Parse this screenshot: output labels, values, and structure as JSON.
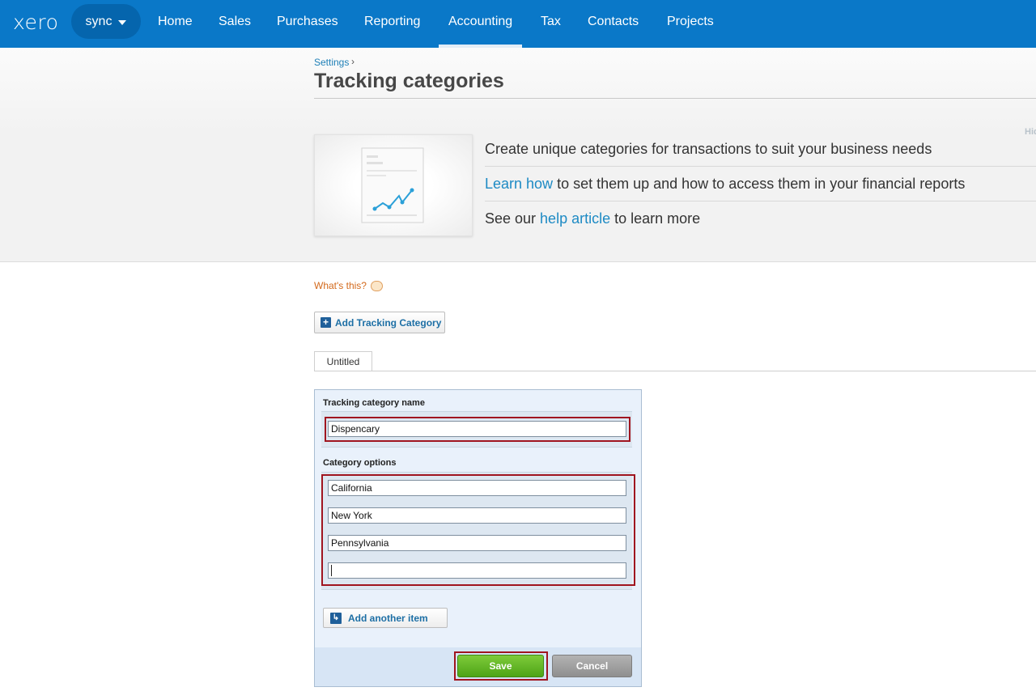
{
  "nav": {
    "logo": "xero",
    "org": "sync",
    "items": [
      {
        "label": "Home"
      },
      {
        "label": "Sales"
      },
      {
        "label": "Purchases"
      },
      {
        "label": "Reporting"
      },
      {
        "label": "Accounting"
      },
      {
        "label": "Tax"
      },
      {
        "label": "Contacts"
      },
      {
        "label": "Projects"
      }
    ],
    "active": "Accounting"
  },
  "breadcrumb": {
    "parent": "Settings",
    "separator": "›"
  },
  "page": {
    "title": "Tracking categories"
  },
  "info": {
    "line1": "Create unique categories for transactions to suit your business needs",
    "line2_link": "Learn how",
    "line2_rest": " to set them up and how to access them in your financial reports",
    "line3_pre": "See our ",
    "line3_link": "help article",
    "line3_post": " to learn more",
    "hide_label": "Hide"
  },
  "whats_this": "What's this?",
  "add_category_label": "Add Tracking Category",
  "tabs": [
    {
      "label": "Untitled"
    }
  ],
  "form": {
    "name_label": "Tracking category name",
    "name_value": "Dispencary",
    "options_label": "Category options",
    "options": [
      "California",
      "New York",
      "Pennsylvania",
      ""
    ],
    "add_item_label": "Add another item",
    "save_label": "Save",
    "cancel_label": "Cancel"
  },
  "colors": {
    "nav_bg": "#0a78c8",
    "link": "#1d8ac4",
    "highlight": "#a0151f",
    "save": "#5cb323"
  }
}
